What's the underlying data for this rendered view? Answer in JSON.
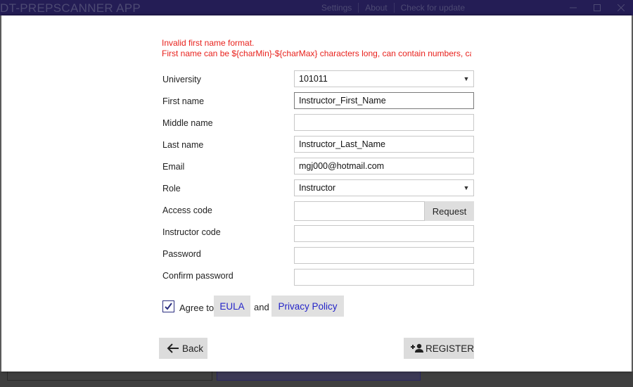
{
  "app": {
    "title": "DT-PREPSCANNER APP",
    "menu": [
      "Settings",
      "About",
      "Check for update"
    ],
    "window_controls": [
      "minimize-icon",
      "maximize-icon",
      "close-icon"
    ]
  },
  "error": {
    "line1": "Invalid first name format.",
    "line2": "First name can be ${charMin}-${charMax} characters long, can contain numbers, car"
  },
  "form": {
    "university": {
      "label": "University",
      "value": "101011"
    },
    "first_name": {
      "label": "First name",
      "value": "Instructor_First_Name"
    },
    "middle_name": {
      "label": "Middle name",
      "value": ""
    },
    "last_name": {
      "label": "Last name",
      "value": "Instructor_Last_Name"
    },
    "email": {
      "label": "Email",
      "value": "mgj000@hotmail.com"
    },
    "role": {
      "label": "Role",
      "value": "Instructor"
    },
    "access_code": {
      "label": "Access code",
      "value": "",
      "request_label": "Request"
    },
    "instructor_code": {
      "label": "Instructor code",
      "value": ""
    },
    "password": {
      "label": "Password",
      "value": ""
    },
    "confirm_password": {
      "label": "Confirm password",
      "value": ""
    }
  },
  "agreement": {
    "checked": true,
    "agree_text": "Agree to",
    "eula_label": "EULA",
    "and_text": "and",
    "privacy_label": "Privacy Policy"
  },
  "actions": {
    "back_label": "Back",
    "register_label": "REGISTER"
  },
  "colors": {
    "titlebar": "#241d55",
    "error": "#e8211c",
    "link": "#2424c8",
    "button_bg": "#dcdcdc"
  }
}
